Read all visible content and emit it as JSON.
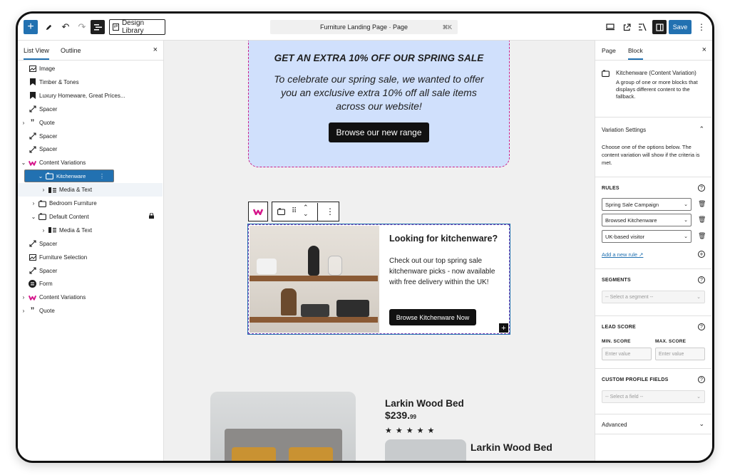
{
  "topbar": {
    "add": "+",
    "edit_icon": "pencil-icon",
    "undo": "↶",
    "redo": "↷",
    "list_view_icon": "list-view-icon",
    "design_library": "Design Library",
    "title": "Furniture Landing Page · Page",
    "shortcut": "⌘K",
    "save": "Save",
    "more": "⋮"
  },
  "left_panel": {
    "tabs": [
      "List View",
      "Outline"
    ],
    "close": "×",
    "items": [
      {
        "label": "Image",
        "icon": "image-icon",
        "indent": 0,
        "caret": ""
      },
      {
        "label": "Timber & Tones",
        "icon": "bookmark-icon",
        "indent": 0,
        "caret": ""
      },
      {
        "label": "Luxury Homeware, Great Prices...",
        "icon": "bookmark-icon",
        "indent": 0,
        "caret": ""
      },
      {
        "label": "Spacer",
        "icon": "spacer-icon",
        "indent": 0,
        "caret": ""
      },
      {
        "label": "Quote",
        "icon": "quote-icon",
        "indent": 0,
        "caret": "›"
      },
      {
        "label": "Spacer",
        "icon": "spacer-icon",
        "indent": 0,
        "caret": ""
      },
      {
        "label": "Spacer",
        "icon": "spacer-icon",
        "indent": 0,
        "caret": ""
      },
      {
        "label": "Content Variations",
        "icon": "variations-icon",
        "indent": 0,
        "caret": "⌄"
      },
      {
        "label": "Kitchenware",
        "icon": "group-icon",
        "indent": 1,
        "caret": "⌄",
        "selected": true
      },
      {
        "label": "Media & Text",
        "icon": "media-text-icon",
        "indent": 2,
        "caret": "›",
        "sub": true
      },
      {
        "label": "Bedroom Furniture",
        "icon": "group-icon",
        "indent": 1,
        "caret": "›"
      },
      {
        "label": "Default Content",
        "icon": "group-icon",
        "indent": 1,
        "caret": "⌄",
        "lock": true
      },
      {
        "label": "Media & Text",
        "icon": "media-text-icon",
        "indent": 2,
        "caret": "›"
      },
      {
        "label": "Spacer",
        "icon": "spacer-icon",
        "indent": 0,
        "caret": ""
      },
      {
        "label": "Furniture Selection",
        "icon": "image-icon",
        "indent": 0,
        "caret": ""
      },
      {
        "label": "Spacer",
        "icon": "spacer-icon",
        "indent": 0,
        "caret": ""
      },
      {
        "label": "Form",
        "icon": "form-icon",
        "indent": 0,
        "caret": ""
      },
      {
        "label": "Content Variations",
        "icon": "variations-icon",
        "indent": 0,
        "caret": "›"
      },
      {
        "label": "Quote",
        "icon": "quote-icon",
        "indent": 0,
        "caret": "›"
      }
    ]
  },
  "canvas": {
    "promo": {
      "heading": "GET AN EXTRA 10% OFF OUR SPRING SALE",
      "body": "To celebrate our spring sale, we wanted to offer you an exclusive extra 10% off all sale items across our website!",
      "button": "Browse our new range"
    },
    "kitchen": {
      "heading": "Looking for kitchenware?",
      "body": "Check out our top spring sale kitchenware picks - now available with free delivery within the UK!",
      "button": "Browse Kitchenware Now"
    },
    "product": {
      "title": "Larkin Wood Bed",
      "price": "$239.",
      "price_cents": "99",
      "stars": "★★★★★",
      "title2": "Larkin Wood Bed"
    }
  },
  "right_panel": {
    "tabs": [
      "Page",
      "Block"
    ],
    "close": "×",
    "block_name": "Kitchenware (Content Variation)",
    "block_desc": "A group of one or more blocks that displays different content to the fallback.",
    "variation_settings": "Variation Settings",
    "variation_help": "Choose one of the options below. The content variation will show if the criteria is met.",
    "rules_label": "RULES",
    "rules": [
      "Spring Sale Campaign",
      "Browsed Kitchenware",
      "UK-based visitor"
    ],
    "add_rule": "Add a new rule ↗",
    "segments_label": "SEGMENTS",
    "segment_placeholder": "-- Select a segment --",
    "lead_score_label": "LEAD SCORE",
    "min_label": "MIN. SCORE",
    "max_label": "MAX. SCORE",
    "min_placeholder": "Enter value",
    "max_placeholder": "Enter value",
    "custom_fields_label": "CUSTOM PROFILE FIELDS",
    "field_placeholder": "-- Select a field --",
    "advanced": "Advanced"
  },
  "colors": {
    "accent": "#2271b1",
    "promo_bg": "#d0e0fc",
    "brand_pink": "#d6168b"
  }
}
